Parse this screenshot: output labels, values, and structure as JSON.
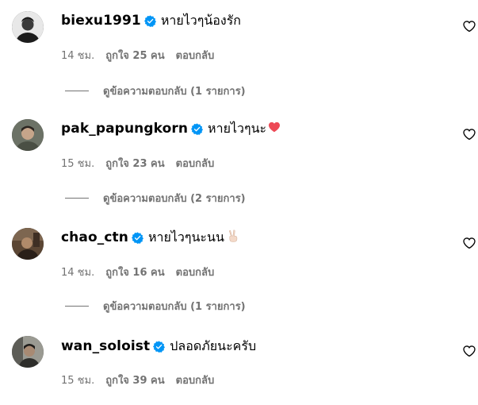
{
  "comments": [
    {
      "username": "biexu1991",
      "text": "หายไวๆน้องรัก",
      "emoji": "",
      "time": "14 ชม.",
      "likes": "ถูกใจ 25 คน",
      "reply": "ตอบกลับ",
      "view_replies": "ดูข้อความตอบกลับ (1 รายการ)"
    },
    {
      "username": "pak_papungkorn",
      "text": "หายไวๆนะ",
      "emoji": "❤",
      "time": "15 ชม.",
      "likes": "ถูกใจ 23 คน",
      "reply": "ตอบกลับ",
      "view_replies": "ดูข้อความตอบกลับ (2 รายการ)"
    },
    {
      "username": "chao_ctn",
      "text": "หายไวๆนะนน",
      "emoji": "✌",
      "time": "14 ชม.",
      "likes": "ถูกใจ 16 คน",
      "reply": "ตอบกลับ",
      "view_replies": "ดูข้อความตอบกลับ (1 รายการ)"
    },
    {
      "username": "wan_soloist",
      "text": "ปลอดภัยนะครับ",
      "emoji": "",
      "time": "15 ชม.",
      "likes": "ถูกใจ 39 คน",
      "reply": "ตอบกลับ"
    }
  ],
  "icons": {
    "verified": "verified-badge-icon",
    "like": "heart-outline-icon"
  },
  "colors": {
    "verified_blue": "#0095f6",
    "meta_gray": "#737373",
    "heart_red": "#ed4956"
  }
}
